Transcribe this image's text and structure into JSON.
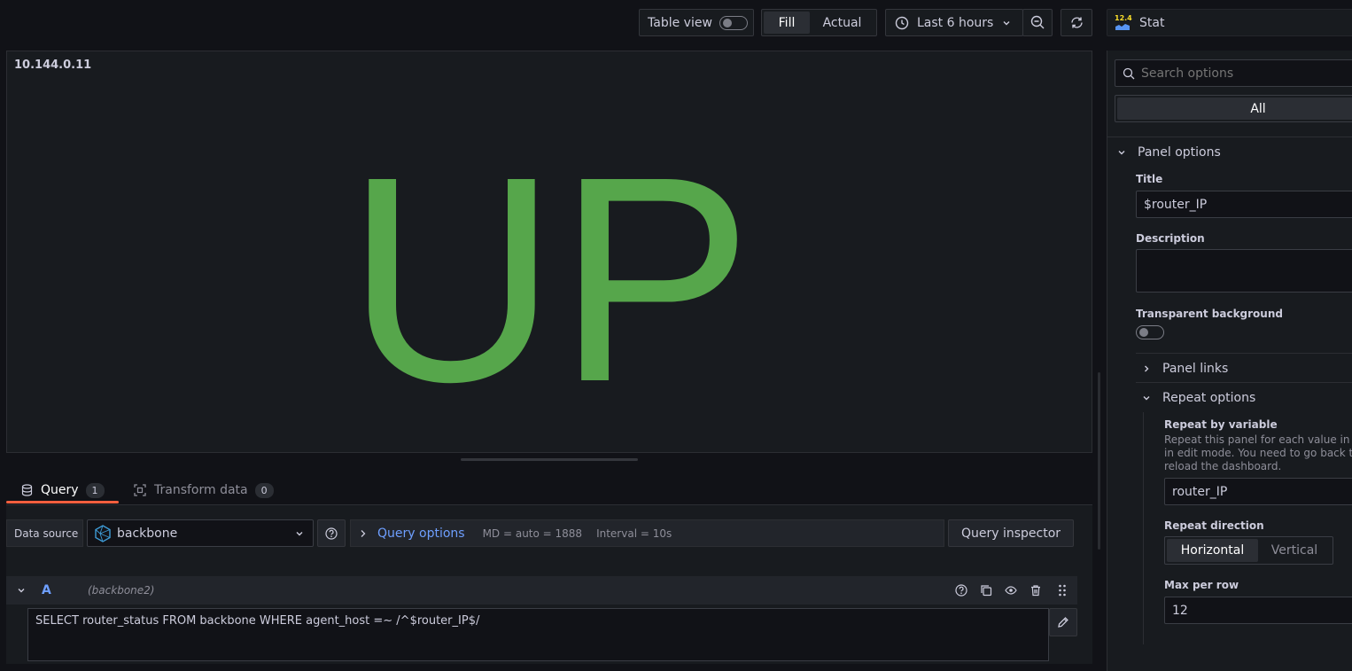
{
  "toolbar": {
    "table_view_label": "Table view",
    "fill_label": "Fill",
    "actual_label": "Actual",
    "time_range": "Last 6 hours",
    "viz_badge": "12.4",
    "viz_name": "Stat"
  },
  "panel": {
    "title": "10.144.0.11",
    "value": "UP",
    "value_color": "#56a64b"
  },
  "tabs": [
    {
      "label": "Query",
      "count": "1"
    },
    {
      "label": "Transform data",
      "count": "0"
    }
  ],
  "query": {
    "data_source_label": "Data source",
    "data_source": "backbone",
    "options_label": "Query options",
    "md": "MD = auto = 1888",
    "interval": "Interval = 10s",
    "inspector_label": "Query inspector",
    "ref_id": "A",
    "ds_name": "(backbone2)",
    "sql": "SELECT router_status FROM backbone WHERE agent_host =~ /^$router_IP$/"
  },
  "options": {
    "search_placeholder": "Search options",
    "all_label": "All",
    "panel_options_label": "Panel options",
    "title_label": "Title",
    "title_value": "$router_IP",
    "description_label": "Description",
    "transparent_label": "Transparent background",
    "panel_links_label": "Panel links",
    "repeat_options_label": "Repeat options",
    "repeat_by_label": "Repeat by variable",
    "repeat_desc": "Repeat this panel for each value in the selected variable. This is not visible while in edit mode. You need to go back to the dashboard and then update the variable or reload the dashboard.",
    "repeat_desc_l1": "Repeat this panel for each value in th",
    "repeat_desc_l2": "in edit mode. You need to go back to",
    "repeat_desc_l3": "reload the dashboard.",
    "repeat_var": "router_IP",
    "repeat_direction_label": "Repeat direction",
    "horizontal_label": "Horizontal",
    "vertical_label": "Vertical",
    "max_per_row_label": "Max per row",
    "max_per_row": "12"
  }
}
